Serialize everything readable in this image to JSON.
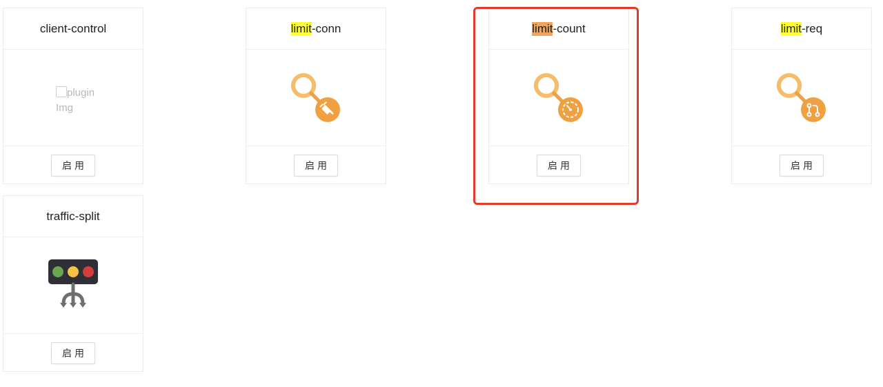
{
  "plugins": [
    {
      "name": "client-control",
      "highlight": "",
      "rest": "client-control",
      "image_alt": "pluginImg",
      "image_broken": true,
      "icon": "broken-image",
      "button_label": "启用"
    },
    {
      "name": "limit-conn",
      "highlight": "limit",
      "rest": "-conn",
      "icon": "magnifier-plug-icon",
      "button_label": "启用"
    },
    {
      "name": "limit-count",
      "highlight": "limit",
      "rest": "-count",
      "icon": "magnifier-timer-icon",
      "button_label": "启用",
      "selected": true
    },
    {
      "name": "limit-req",
      "highlight": "limit",
      "rest": "-req",
      "icon": "magnifier-branch-icon",
      "button_label": "启用"
    },
    {
      "name": "traffic-split",
      "highlight": "",
      "rest": "traffic-split",
      "icon": "traffic-light-split-icon",
      "button_label": "启用"
    }
  ],
  "colors": {
    "icon_orange": "#f0a040",
    "icon_orange_light": "#f4bd6b",
    "search_highlight": "#ffff33",
    "current_highlight": "#f0a45c",
    "selection_border": "#e03c2c",
    "traffic_green": "#6aa84f",
    "traffic_yellow": "#f6c243",
    "traffic_red": "#d33d3d"
  }
}
